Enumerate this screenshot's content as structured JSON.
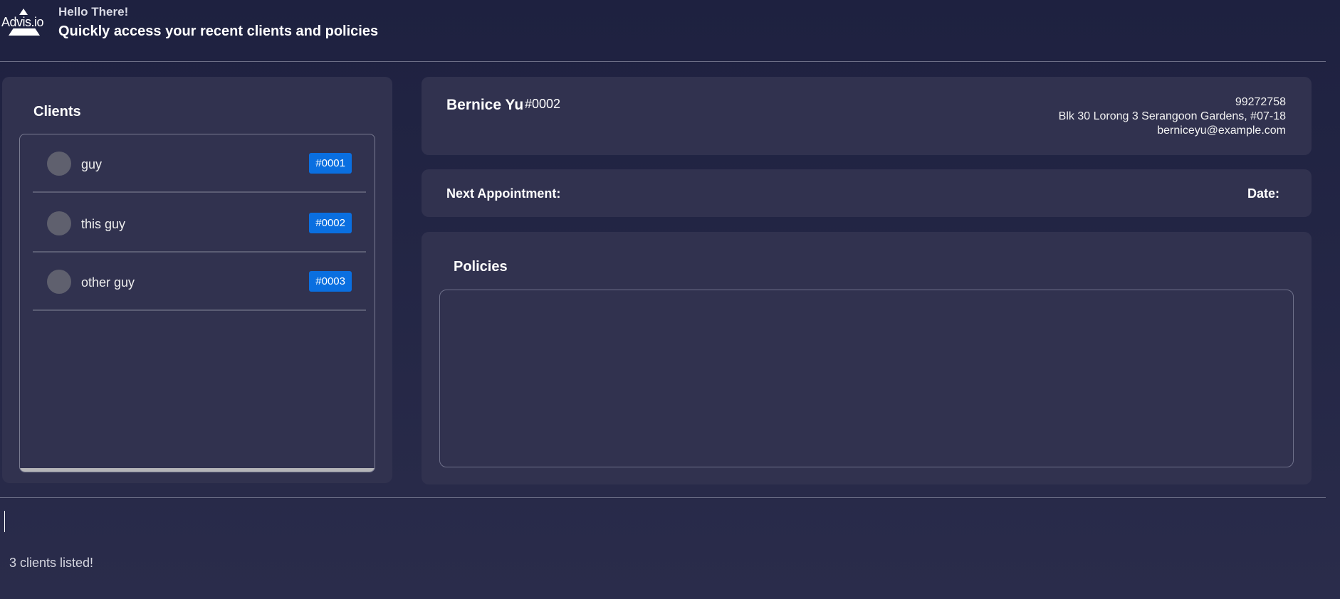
{
  "app": {
    "logo_text": "Advis.io"
  },
  "header": {
    "greeting": "Hello There!",
    "subtitle": "Quickly access your recent clients and policies"
  },
  "clients": {
    "title": "Clients",
    "items": [
      {
        "name": "guy",
        "id": "#0001"
      },
      {
        "name": "this guy",
        "id": "#0002"
      },
      {
        "name": "other guy",
        "id": "#0003"
      }
    ]
  },
  "selected_client": {
    "name": "Bernice Yu",
    "id": "#0002",
    "phone": "99272758",
    "address": "Blk 30 Lorong 3 Serangoon Gardens, #07-18",
    "email": "berniceyu@example.com"
  },
  "appointment": {
    "next_label": "Next Appointment:",
    "date_label": "Date:"
  },
  "policies": {
    "title": "Policies",
    "items": []
  },
  "command": {
    "value": ""
  },
  "result": {
    "message": "3 clients listed!"
  },
  "colors": {
    "background": "#1e2140",
    "panel": "#31324f",
    "accent": "#0a6fe0",
    "divider": "#6c6e86"
  }
}
